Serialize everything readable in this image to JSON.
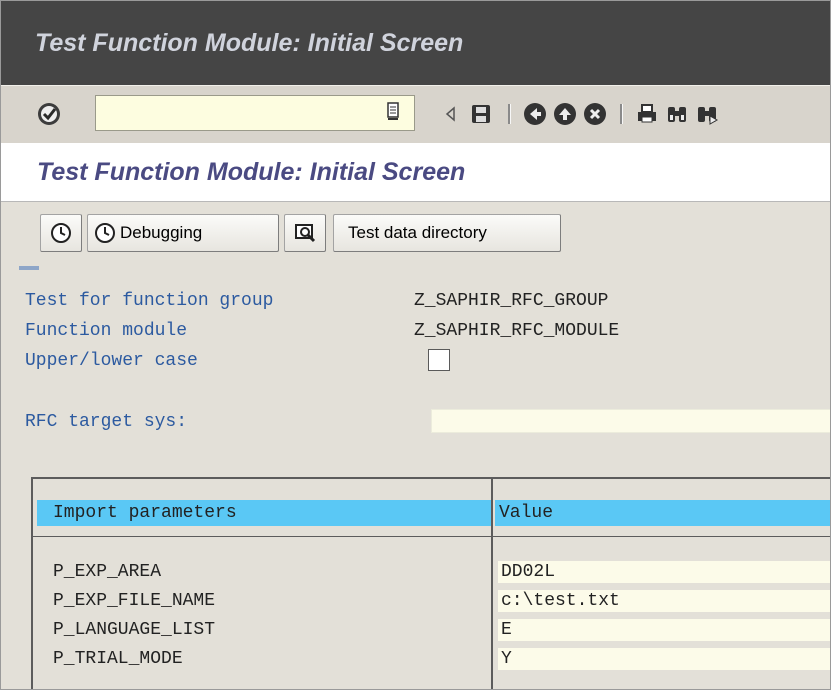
{
  "window": {
    "title": "Test Function Module: Initial Screen"
  },
  "toolbar": {
    "command_field_value": "",
    "icons": [
      "enter-checkmark-icon",
      "command-dropdown-icon",
      "back-arrow-icon",
      "save-icon",
      "back-icon",
      "exit-icon",
      "cancel-icon",
      "print-icon",
      "find-icon",
      "find-next-icon"
    ]
  },
  "screen": {
    "title": "Test Function Module: Initial Screen"
  },
  "app_toolbar": {
    "execute_icon": "execute-clock-icon",
    "debugging_label": "Debugging",
    "test_icon": "magnify-screen-icon",
    "test_data_directory_label": "Test data directory"
  },
  "form": {
    "function_group_label": "Test for function group",
    "function_group_value": "Z_SAPHIR_RFC_GROUP",
    "function_module_label": "Function module",
    "function_module_value": "Z_SAPHIR_RFC_MODULE",
    "case_label": "Upper/lower case",
    "case_checked": false,
    "rfc_label": "RFC target sys:",
    "rfc_value": ""
  },
  "table": {
    "headers": [
      "Import parameters",
      "Value"
    ],
    "rows": [
      {
        "name": "P_EXP_AREA",
        "value": "DD02L"
      },
      {
        "name": "P_EXP_FILE_NAME",
        "value": "c:\\test.txt"
      },
      {
        "name": "P_LANGUAGE_LIST",
        "value": "E"
      },
      {
        "name": "P_TRIAL_MODE",
        "value": "Y"
      }
    ]
  },
  "colors": {
    "title_bar": "#454545",
    "screen_title_text": "#4a4a82",
    "label_text": "#2c5aa0",
    "table_header": "#5ac8f5",
    "input_bg": "#fcfbe9"
  }
}
